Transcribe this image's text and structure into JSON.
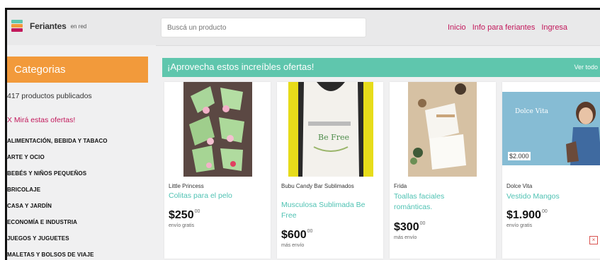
{
  "header": {
    "logo_name": "Feriantes",
    "logo_sub": "en red",
    "search_placeholder": "Buscá un producto",
    "nav": [
      "Inicio",
      "Info para feriantes",
      "Ingresa"
    ]
  },
  "sidebar": {
    "title": "Categorias",
    "count_text": "417 productos publicados",
    "offers_link": "X Mirá estas ofertas!",
    "categories": [
      "ALIMENTACIÓN, BEBIDA Y TABACO",
      "ARTE Y OCIO",
      "BEBÉS Y NIÑOS PEQUEÑOS",
      "BRICOLAJE",
      "CASA Y JARDÍN",
      "ECONOMÍA E INDUSTRIA",
      "JUEGOS Y JUGUETES",
      "MALETAS Y BOLSOS DE VIAJE"
    ]
  },
  "banner": {
    "title": "¡Aprovecha estos increíbles ofertas!",
    "more_link": "Ver todo"
  },
  "products": [
    {
      "brand": "Little Princess",
      "name": "Colitas para el pelo",
      "price": "$250",
      "cents": "00",
      "shipping": "envío gratis"
    },
    {
      "brand": "Bubu Candy Bar Sublimados",
      "name": "Musculosa Sublimada Be Free",
      "price": "$600",
      "cents": "00",
      "shipping": "más envío"
    },
    {
      "brand": "Frida",
      "name": "Toallas faciales románticas.",
      "price": "$300",
      "cents": "00",
      "shipping": "más envío"
    },
    {
      "brand": "Dolce Vita",
      "name": "Vestido Mangos",
      "price": "$1.900",
      "cents": "00",
      "shipping": "envío gratis",
      "image_tag": "$2.000"
    }
  ],
  "colors": {
    "accent_pink": "#c2185b",
    "category_orange": "#f29a3b",
    "banner_teal": "#5fc6ad",
    "product_name_teal": "#4fc2b3"
  }
}
